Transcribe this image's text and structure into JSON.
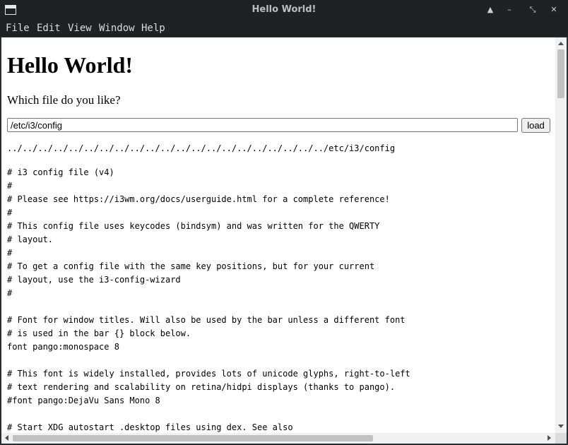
{
  "window": {
    "title": "Hello World!",
    "controls": {
      "shade": "▲",
      "minimize": "–",
      "restore": "⤡",
      "close": "✕"
    }
  },
  "menu": [
    "File",
    "Edit",
    "View",
    "Window",
    "Help"
  ],
  "page": {
    "heading": "Hello World!",
    "question": "Which file do you like?",
    "path_input": {
      "value": "/etc/i3/config",
      "placeholder": ""
    },
    "load_button": "load",
    "resolved_path": "../../../../../../../../../../../../../../../../../../../../../etc/i3/config",
    "file_lines": [
      "# i3 config file (v4)",
      "#",
      "# Please see https://i3wm.org/docs/userguide.html for a complete reference!",
      "#",
      "# This config file uses keycodes (bindsym) and was written for the QWERTY",
      "# layout.",
      "#",
      "# To get a config file with the same key positions, but for your current",
      "# layout, use the i3-config-wizard",
      "#",
      "",
      "# Font for window titles. Will also be used by the bar unless a different font",
      "# is used in the bar {} block below.",
      "font pango:monospace 8",
      "",
      "# This font is widely installed, provides lots of unicode glyphs, right-to-left",
      "# text rendering and scalability on retina/hidpi displays (thanks to pango).",
      "#font pango:DejaVu Sans Mono 8",
      "",
      "# Start XDG autostart .desktop files using dex. See also"
    ]
  }
}
